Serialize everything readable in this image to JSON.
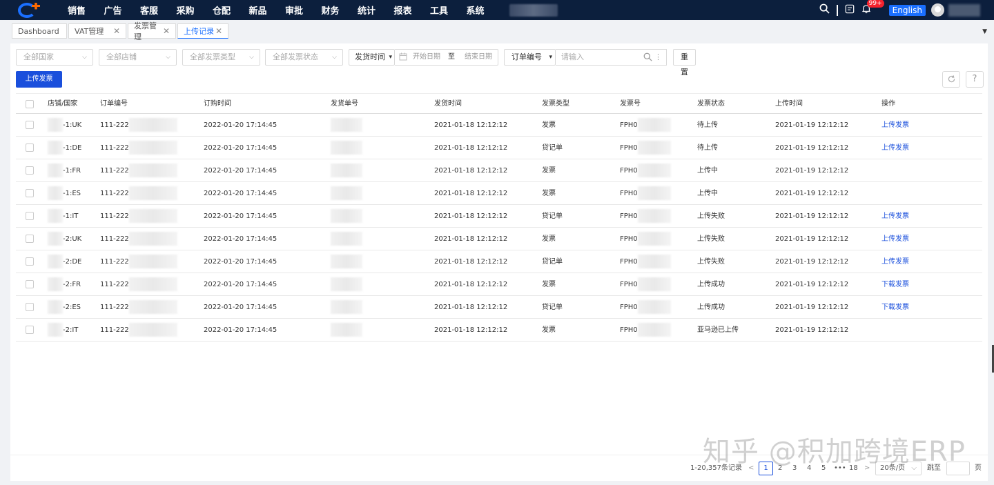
{
  "nav": {
    "items": [
      "销售",
      "广告",
      "客服",
      "采购",
      "仓配",
      "新品",
      "审批",
      "财务",
      "统计",
      "报表",
      "工具",
      "系统"
    ],
    "notifications_badge": "99+",
    "language_label": "English"
  },
  "tabs": [
    {
      "label": "Dashboard",
      "closable": false,
      "active": false
    },
    {
      "label": "VAT管理",
      "closable": true,
      "active": false
    },
    {
      "label": "发票管理",
      "closable": true,
      "active": false
    },
    {
      "label": "上传记录",
      "closable": true,
      "active": true
    }
  ],
  "filters": {
    "country": "全部国家",
    "shop": "全部店铺",
    "invoice_type": "全部发票类型",
    "invoice_status": "全部发票状态",
    "time_field": "发货时间",
    "start_date": "开始日期",
    "range_sep": "至",
    "end_date": "结束日期",
    "search_field": "订单编号",
    "search_placeholder": "请输入",
    "reset_label": "重置"
  },
  "toolbar": {
    "upload_label": "上传发票",
    "refresh_icon": "refresh-icon",
    "help_label": "?"
  },
  "table": {
    "headers": [
      "店铺/国家",
      "订单编号",
      "订购时间",
      "发货单号",
      "发货时间",
      "发票类型",
      "发票号",
      "发票状态",
      "上传时间",
      "操作"
    ],
    "rows": [
      {
        "shop": "-1:UK",
        "order": "111-222",
        "order_time": "2022-01-20 17:14:45",
        "ship_time": "2021-01-18 12:12:12",
        "type": "发票",
        "invoice_no": "FPH0",
        "status": "待上传",
        "upload_time": "2021-01-19 12:12:12",
        "action": "上传发票"
      },
      {
        "shop": "-1:DE",
        "order": "111-222",
        "order_time": "2022-01-20 17:14:45",
        "ship_time": "2021-01-18 12:12:12",
        "type": "贷记单",
        "invoice_no": "FPH0",
        "status": "待上传",
        "upload_time": "2021-01-19 12:12:12",
        "action": "上传发票"
      },
      {
        "shop": "-1:FR",
        "order": "111-222",
        "order_time": "2022-01-20 17:14:45",
        "ship_time": "2021-01-18 12:12:12",
        "type": "发票",
        "invoice_no": "FPH0",
        "status": "上传中",
        "upload_time": "2021-01-19 12:12:12",
        "action": ""
      },
      {
        "shop": "-1:ES",
        "order": "111-222",
        "order_time": "2022-01-20 17:14:45",
        "ship_time": "2021-01-18 12:12:12",
        "type": "发票",
        "invoice_no": "FPH0",
        "status": "上传中",
        "upload_time": "2021-01-19 12:12:12",
        "action": ""
      },
      {
        "shop": "-1:IT",
        "order": "111-222",
        "order_time": "2022-01-20 17:14:45",
        "ship_time": "2021-01-18 12:12:12",
        "type": "贷记单",
        "invoice_no": "FPH0",
        "status": "上传失败",
        "upload_time": "2021-01-19 12:12:12",
        "action": "上传发票"
      },
      {
        "shop": "-2:UK",
        "order": "111-222",
        "order_time": "2022-01-20 17:14:45",
        "ship_time": "2021-01-18 12:12:12",
        "type": "发票",
        "invoice_no": "FPH0",
        "status": "上传失败",
        "upload_time": "2021-01-19 12:12:12",
        "action": "上传发票"
      },
      {
        "shop": "-2:DE",
        "order": "111-222",
        "order_time": "2022-01-20 17:14:45",
        "ship_time": "2021-01-18 12:12:12",
        "type": "贷记单",
        "invoice_no": "FPH0",
        "status": "上传失败",
        "upload_time": "2021-01-19 12:12:12",
        "action": "上传发票"
      },
      {
        "shop": "-2:FR",
        "order": "111-222",
        "order_time": "2022-01-20 17:14:45",
        "ship_time": "2021-01-18 12:12:12",
        "type": "发票",
        "invoice_no": "FPH0",
        "status": "上传成功",
        "upload_time": "2021-01-19 12:12:12",
        "action": "下载发票"
      },
      {
        "shop": "-2:ES",
        "order": "111-222",
        "order_time": "2022-01-20 17:14:45",
        "ship_time": "2021-01-18 12:12:12",
        "type": "贷记单",
        "invoice_no": "FPH0",
        "status": "上传成功",
        "upload_time": "2021-01-19 12:12:12",
        "action": "下载发票"
      },
      {
        "shop": "-2:IT",
        "order": "111-222",
        "order_time": "2022-01-20 17:14:45",
        "ship_time": "2021-01-18 12:12:12",
        "type": "发票",
        "invoice_no": "FPH0",
        "status": "亚马逊已上传",
        "upload_time": "2021-01-19 12:12:12",
        "action": ""
      }
    ]
  },
  "pagination": {
    "total_text": "1-20,357条记录",
    "pages": [
      "1",
      "2",
      "3",
      "4",
      "5"
    ],
    "ellipsis": "•••",
    "last_page": "18",
    "page_size": "20条/页",
    "jump_label": "跳至",
    "page_unit": "页"
  },
  "watermark": "知乎 @积加跨境ERP",
  "colors": {
    "primary": "#1a4fdc",
    "nav_bg": "#0c1f3d",
    "badge": "#f5222d",
    "logo_accent": "#ff6a00"
  }
}
